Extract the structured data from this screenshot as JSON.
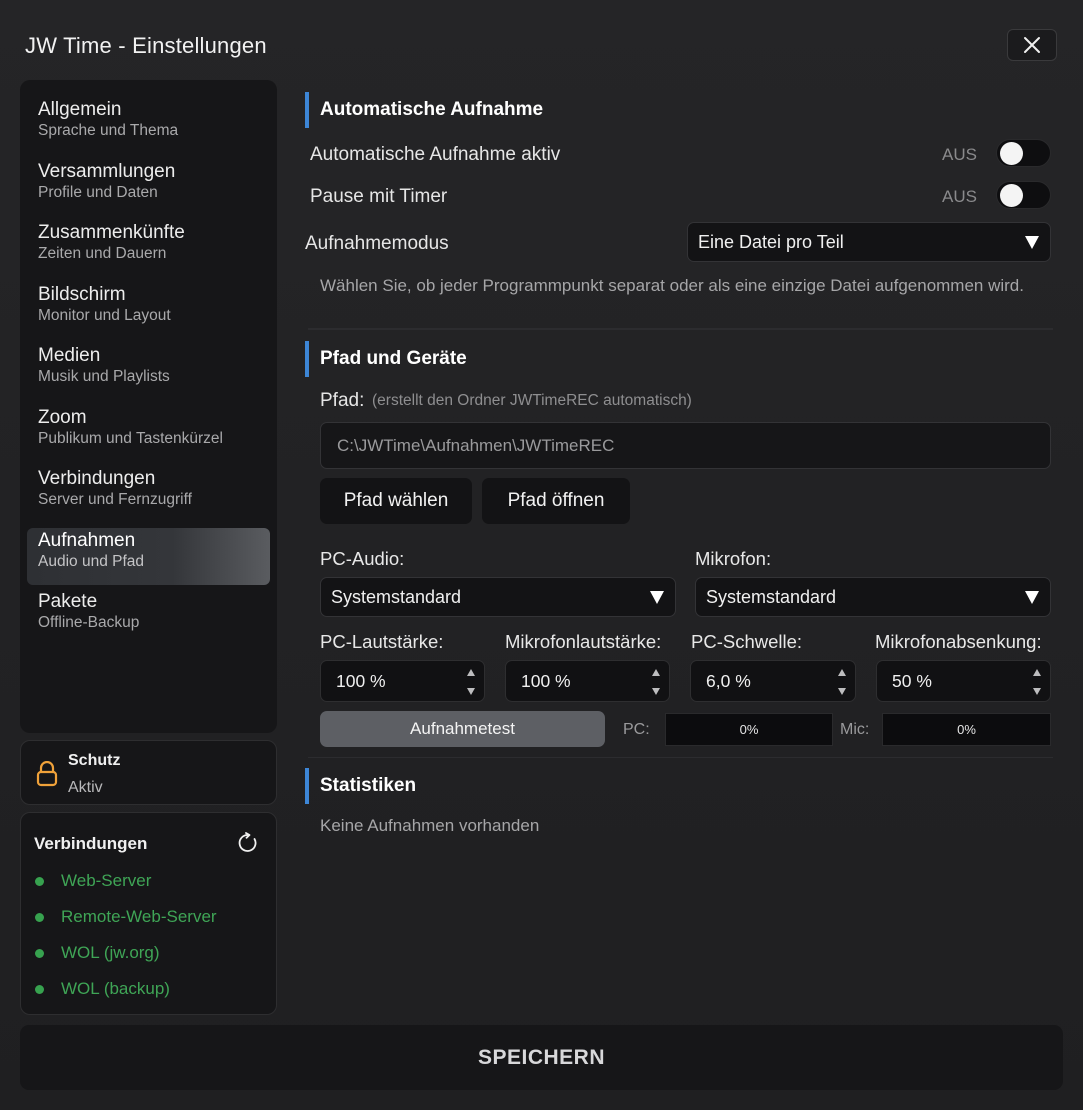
{
  "window": {
    "title": "JW Time - Einstellungen"
  },
  "sidebar": {
    "items": [
      {
        "label": "Allgemein",
        "sub": "Sprache und Thema"
      },
      {
        "label": "Versammlungen",
        "sub": "Profile und Daten"
      },
      {
        "label": "Zusammenkünfte",
        "sub": "Zeiten und Dauern"
      },
      {
        "label": "Bildschirm",
        "sub": "Monitor und Layout"
      },
      {
        "label": "Medien",
        "sub": "Musik und Playlists"
      },
      {
        "label": "Zoom",
        "sub": "Publikum und Tastenkürzel"
      },
      {
        "label": "Verbindungen",
        "sub": "Server und Fernzugriff"
      },
      {
        "label": "Aufnahmen",
        "sub": "Audio und Pfad"
      },
      {
        "label": "Pakete",
        "sub": "Offline-Backup"
      }
    ],
    "active_index": 7
  },
  "protection": {
    "title": "Schutz",
    "status": "Aktiv"
  },
  "connections": {
    "title": "Verbindungen",
    "items": [
      "Web-Server",
      "Remote-Web-Server",
      "WOL (jw.org)",
      "WOL (backup)"
    ],
    "status_color": "#37a24f"
  },
  "auto_recording": {
    "heading": "Automatische Aufnahme",
    "active_label": "Automatische Aufnahme aktiv",
    "active_state": "AUS",
    "pause_label": "Pause mit Timer",
    "pause_state": "AUS",
    "mode_label": "Aufnahmemodus",
    "mode_value": "Eine Datei pro Teil",
    "hint": "Wählen Sie, ob jeder Programmpunkt separat oder als eine einzige Datei aufgenommen wird."
  },
  "path_devices": {
    "heading": "Pfad und Geräte",
    "path_label": "Pfad:",
    "path_hint": "(erstellt den Ordner JWTimeREC automatisch)",
    "path_value": "C:\\JWTime\\Aufnahmen\\JWTimeREC",
    "choose_path": "Pfad wählen",
    "open_path": "Pfad öffnen",
    "pc_audio_label": "PC-Audio:",
    "pc_audio_value": "Systemstandard",
    "mic_label": "Mikrofon:",
    "mic_value": "Systemstandard",
    "pc_volume_label": "PC-Lautstärke:",
    "pc_volume_value": "100 %",
    "mic_volume_label": "Mikrofonlautstärke:",
    "mic_volume_value": "100 %",
    "pc_threshold_label": "PC-Schwelle:",
    "pc_threshold_value": "6,0 %",
    "mic_duck_label": "Mikrofonabsenkung:",
    "mic_duck_value": "50 %",
    "test_button": "Aufnahmetest",
    "pc_meter_label": "PC:",
    "pc_meter_value": "0%",
    "mic_meter_label": "Mic:",
    "mic_meter_value": "0%"
  },
  "statistics": {
    "heading": "Statistiken",
    "empty": "Keine Aufnahmen vorhanden"
  },
  "footer": {
    "save_label": "SPEICHERN"
  },
  "colors": {
    "accent": "#3d86d6",
    "lock": "#f0a23a",
    "ok": "#37a24f"
  }
}
